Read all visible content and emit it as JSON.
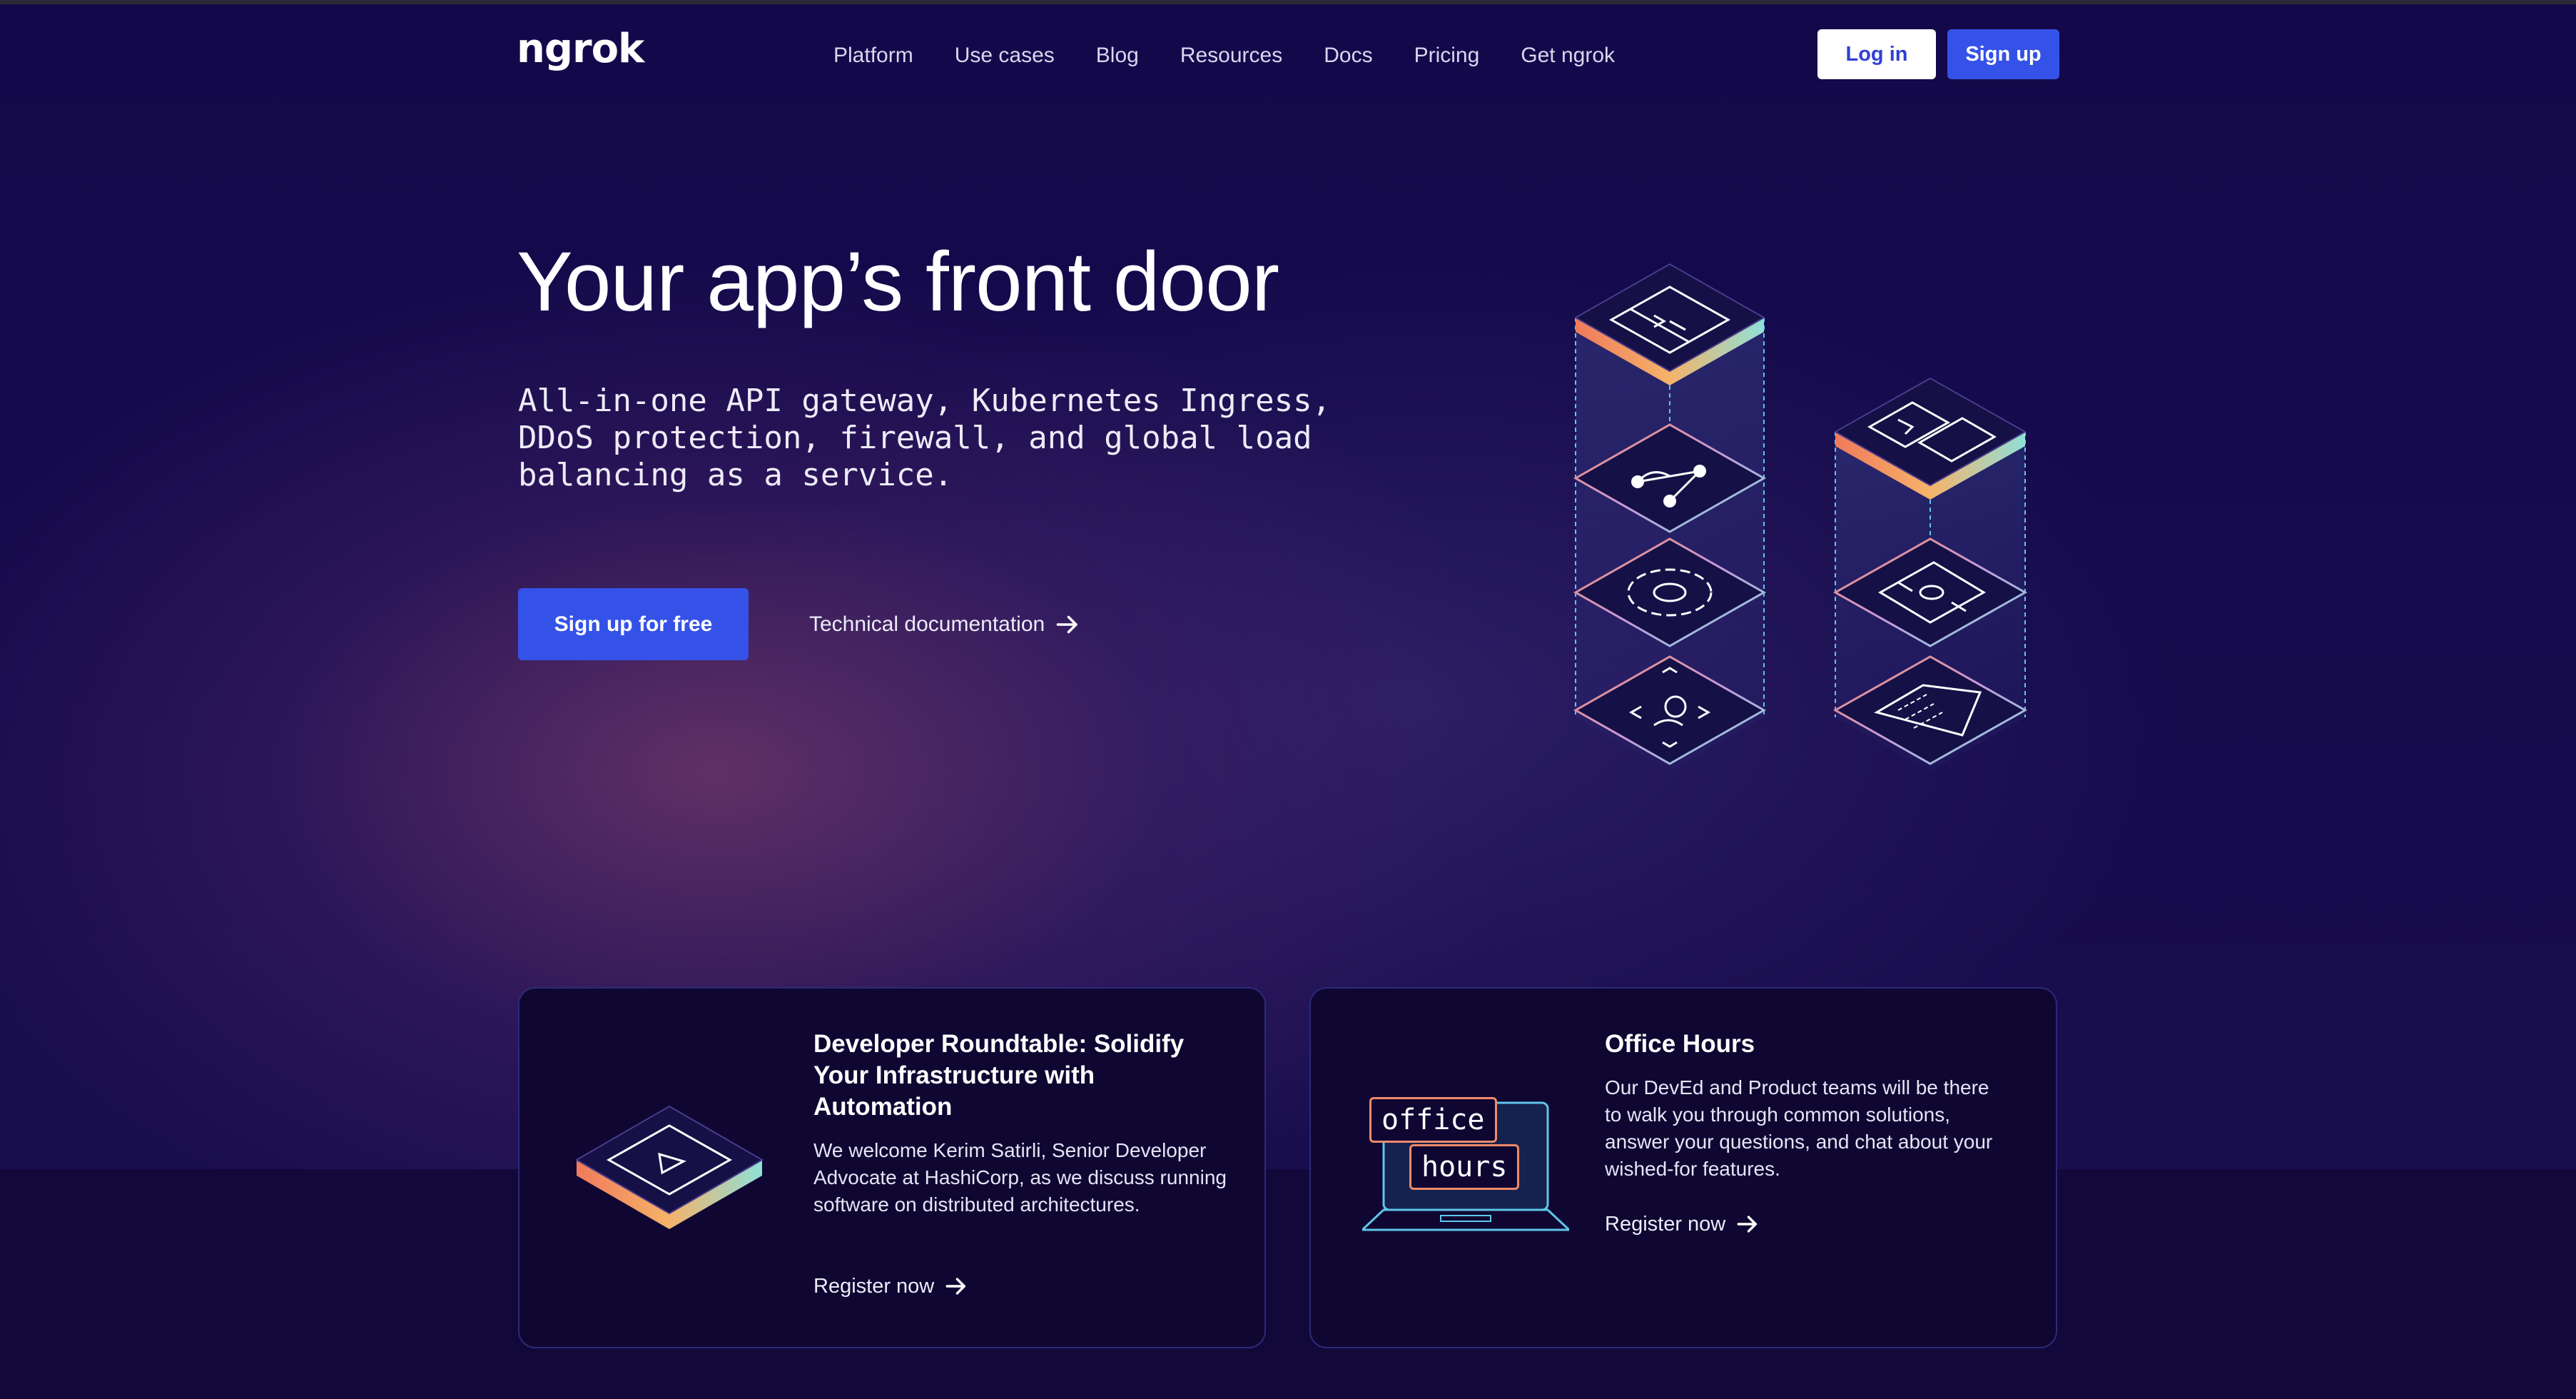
{
  "brand": {
    "logo_text": "ngrok"
  },
  "nav": {
    "items": [
      {
        "label": "Platform"
      },
      {
        "label": "Use cases"
      },
      {
        "label": "Blog"
      },
      {
        "label": "Resources"
      },
      {
        "label": "Docs"
      },
      {
        "label": "Pricing"
      },
      {
        "label": "Get ngrok"
      }
    ],
    "login_label": "Log in",
    "signup_label": "Sign up"
  },
  "hero": {
    "title": "Your app’s front door",
    "subtitle": "All-in-one API gateway, Kubernetes Ingress, DDoS protection, firewall, and global load balancing as a service.",
    "primary_cta": "Sign up for free",
    "secondary_cta": "Technical documentation"
  },
  "cards": [
    {
      "title": "Developer Roundtable: Solidify Your Infrastructure with Automation",
      "body": "We welcome Kerim Satirli, Senior Developer Advocate at HashiCorp, as we discuss running software on distributed architectures.",
      "link": "Register now"
    },
    {
      "title": "Office Hours",
      "body": "Our DevEd and Product teams will be there to walk you through common solutions, answer your questions, and chat about your wished-for features.",
      "link": "Register now",
      "illustration_labels": [
        "office",
        "hours"
      ]
    }
  ],
  "colors": {
    "background": "#120842",
    "accent": "#3552e8",
    "card_bg": "#0f0732",
    "card_border": "#2b2a78"
  },
  "icons": [
    "arrow-right-icon",
    "code-window-icon",
    "nodes-icon",
    "gear-icon",
    "person-scan-icon",
    "terminal-icon",
    "devices-icon",
    "document-icon",
    "play-icon",
    "laptop-icon"
  ]
}
